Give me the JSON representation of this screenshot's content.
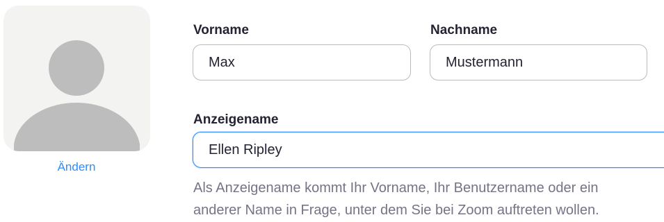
{
  "profile": {
    "change_label": "Ändern"
  },
  "form": {
    "first_name": {
      "label": "Vorname",
      "value": "Max"
    },
    "last_name": {
      "label": "Nachname",
      "value": "Mustermann"
    },
    "display_name": {
      "label": "Anzeigename",
      "value": "Ellen Ripley"
    },
    "help_text": [
      "Als Anzeigename kommt Ihr Vorname, Ihr Benutzername oder ein",
      "anderer Name in Frage, unter dem Sie bei Zoom auftreten wollen."
    ]
  },
  "colors": {
    "accent": "#2d8cff",
    "label": "#232333",
    "help": "#747487",
    "avatar_bg": "#f3f3f2",
    "avatar_figure": "#bdbdbd"
  },
  "icons": {
    "avatar": "default-user-avatar-icon"
  }
}
